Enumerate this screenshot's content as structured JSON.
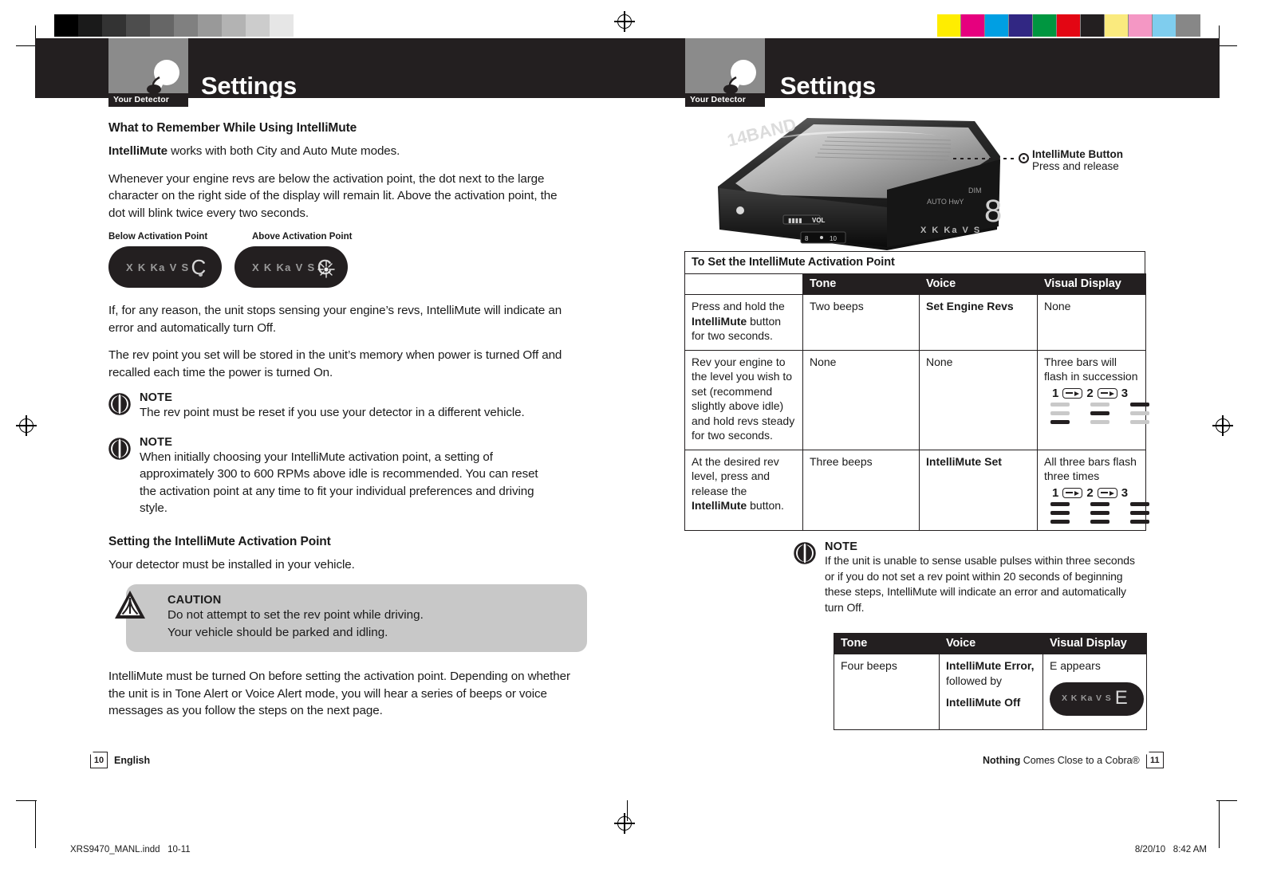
{
  "print_marks": {
    "grey_swatches": [
      "#000000",
      "#1a1a1a",
      "#333333",
      "#4d4d4d",
      "#666666",
      "#808080",
      "#999999",
      "#b3b3b3",
      "#cccccc",
      "#e6e6e6",
      "#ffffff"
    ],
    "color_swatches": [
      "#ffed00",
      "#e6007e",
      "#009fe3",
      "#312783",
      "#009640",
      "#e30613",
      "#231f20",
      "#faea7e",
      "#f497c4",
      "#7fcdee",
      "#878787"
    ],
    "file_name": "XRS9470_MANL.indd",
    "page_range": "10-11",
    "print_date": "8/20/10",
    "print_time": "8:42 AM"
  },
  "header": {
    "tab_label": "Your Detector",
    "title": "Settings",
    "logo_icon": "cobra-snake-icon"
  },
  "left_page": {
    "section_title": "What to Remember While Using IntelliMute",
    "intro_bold": "IntelliMute",
    "intro_rest": " works with both City and Auto Mute modes.",
    "para_1": "Whenever your engine revs are below the activation point, the dot next to the large character on the right side of the display will remain lit. Above the activation point, the dot will blink twice every two seconds.",
    "display_examples": {
      "label_below": "Below Activation Point",
      "label_above": "Above Activation Point",
      "band_text": "X K Ka V S",
      "big_char": "C"
    },
    "para_2": "If, for any reason, the unit stops sensing your engine’s revs, IntelliMute will indicate an error and automatically turn Off.",
    "para_3": "The rev point you set will be stored in the unit’s memory when power is turned Off and recalled each time the power is turned On.",
    "note_1": {
      "title": "NOTE",
      "body": "The rev point must be reset if you use your detector in a different vehicle."
    },
    "note_2": {
      "title": "NOTE",
      "body": "When initially choosing your IntelliMute activation point, a setting of approximately 300 to 600 RPMs above idle is recommended. You can reset the activation point at any time to fit your individual preferences and driving style."
    },
    "section_title_2": "Setting the IntelliMute Activation Point",
    "para_4": "Your detector must be installed in your vehicle.",
    "caution": {
      "title": "CAUTION",
      "line_1": "Do not attempt to set the rev point while driving.",
      "line_2": "Your vehicle should be parked and idling."
    },
    "para_5": "IntelliMute must be turned On before setting the activation point. Depending on whether the unit is in Tone Alert or Voice Alert mode, you will hear a series of beeps or voice messages as you follow the steps on the next page.",
    "footer": {
      "page_number": "10",
      "language": "English"
    }
  },
  "right_page": {
    "callout": {
      "title": "IntelliMute Button",
      "subtitle": "Press and release"
    },
    "table_title": "To Set the IntelliMute Activation Point",
    "table_headers": [
      "Tone",
      "Voice",
      "Visual Display"
    ],
    "table_rows": [
      {
        "step_plain_1": "Press and hold the ",
        "step_bold": "IntelliMute",
        "step_plain_2": " button for two seconds.",
        "tone": "Two beeps",
        "voice": "Set Engine Revs",
        "voice_bold": true,
        "visual": "None",
        "has_bars": false
      },
      {
        "step_plain_1": "Rev your engine to the level you wish to set (recommend slightly above idle) and hold revs steady for two seconds.",
        "step_bold": "",
        "step_plain_2": "",
        "tone": "None",
        "voice": "None",
        "voice_bold": false,
        "visual": "Three bars will flash in succession",
        "has_bars": true,
        "bar_labels": [
          "1",
          "2",
          "3"
        ],
        "bar_pattern": [
          [
            0,
            0,
            1
          ],
          [
            0,
            1,
            0
          ],
          [
            1,
            0,
            0
          ]
        ]
      },
      {
        "step_plain_1": "At the desired rev level, press and release the ",
        "step_bold": "IntelliMute",
        "step_plain_2": " button.",
        "tone": "Three beeps",
        "voice": "IntelliMute Set",
        "voice_bold": true,
        "visual": "All three bars flash three times",
        "has_bars": true,
        "bar_labels": [
          "1",
          "2",
          "3"
        ],
        "bar_pattern": [
          [
            1,
            1,
            1
          ],
          [
            1,
            1,
            1
          ],
          [
            1,
            1,
            1
          ]
        ]
      }
    ],
    "note": {
      "title": "NOTE",
      "body": "If the unit is unable to sense usable pulses within three seconds or if you do not set a rev point within 20 seconds of beginning these steps, IntelliMute will indicate an error and automatically turn Off."
    },
    "error_table_headers": [
      "Tone",
      "Voice",
      "Visual Display"
    ],
    "error_row": {
      "tone": "Four beeps",
      "voice_bold_1": "IntelliMute Error,",
      "voice_plain": "followed by",
      "voice_bold_2": "IntelliMute Off",
      "visual": "E appears",
      "lcd_band": "X K Ka V S",
      "lcd_char": "E"
    },
    "footer": {
      "tagline_bold": "Nothing",
      "tagline_rest": " Comes Close to a Cobra®",
      "page_number": "11"
    }
  },
  "colors": {
    "header_dark": "#231f20",
    "tab_grey": "#8b8b8b",
    "caution_grey": "#c8c8c8",
    "bar_on": "#231f20",
    "bar_off": "#c9c9c9"
  }
}
